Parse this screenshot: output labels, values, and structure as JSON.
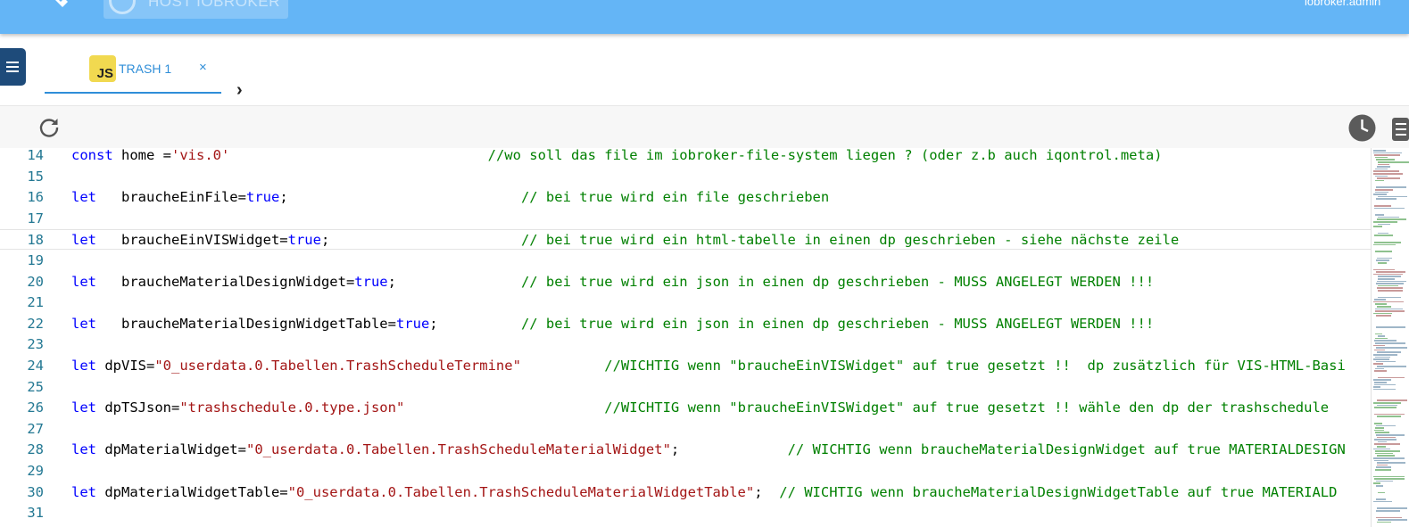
{
  "header": {
    "host_label": "HOST IOBROKER",
    "user_label": "iobroker.admin"
  },
  "icons": {
    "wrench": "wrench-icon",
    "host": "host-icon",
    "menu": "menu-icon",
    "reload": "reload-icon",
    "clock": "clock-icon",
    "list": "list-icon"
  },
  "tabs": [
    {
      "badge": "JS",
      "label": "TRASH 1",
      "close": "×"
    }
  ],
  "tab_scroll": "›",
  "colors": {
    "appbar": "#64b5f6",
    "tab_accent": "#2f8ed8",
    "keyword": "#0000ff",
    "string": "#a31515",
    "comment": "#008000",
    "line_number": "#237893"
  },
  "editor": {
    "current_line": "18",
    "lines": [
      {
        "n": "14",
        "parts": [
          {
            "t": "kw",
            "v": "const"
          },
          {
            "t": "p",
            "v": " home ="
          },
          {
            "t": "str",
            "v": "'vis.0'"
          },
          {
            "t": "p",
            "v": "                               "
          },
          {
            "t": "cm",
            "v": "//wo soll das file im iobroker-file-system liegen ? (oder z.b auch iqontrol.meta)"
          }
        ]
      },
      {
        "n": "15",
        "parts": []
      },
      {
        "n": "16",
        "parts": [
          {
            "t": "kw",
            "v": "let"
          },
          {
            "t": "p",
            "v": "   braucheEinFile="
          },
          {
            "t": "kw",
            "v": "true"
          },
          {
            "t": "p",
            "v": ";                            "
          },
          {
            "t": "cm",
            "v": "// bei true wird ein file geschrieben"
          }
        ]
      },
      {
        "n": "17",
        "parts": []
      },
      {
        "n": "18",
        "parts": [
          {
            "t": "kw",
            "v": "let"
          },
          {
            "t": "p",
            "v": "   braucheEinVISWidget="
          },
          {
            "t": "kw",
            "v": "true"
          },
          {
            "t": "p",
            "v": ";                       "
          },
          {
            "t": "cm",
            "v": "// bei true wird ein html-tabelle in einen dp geschrieben - siehe nächste zeile"
          }
        ]
      },
      {
        "n": "19",
        "parts": []
      },
      {
        "n": "20",
        "parts": [
          {
            "t": "kw",
            "v": "let"
          },
          {
            "t": "p",
            "v": "   braucheMaterialDesignWidget="
          },
          {
            "t": "kw",
            "v": "true"
          },
          {
            "t": "p",
            "v": ";               "
          },
          {
            "t": "cm",
            "v": "// bei true wird ein json in einen dp geschrieben - MUSS ANGELEGT WERDEN !!!"
          }
        ]
      },
      {
        "n": "21",
        "parts": []
      },
      {
        "n": "22",
        "parts": [
          {
            "t": "kw",
            "v": "let"
          },
          {
            "t": "p",
            "v": "   braucheMaterialDesignWidgetTable="
          },
          {
            "t": "kw",
            "v": "true"
          },
          {
            "t": "p",
            "v": ";          "
          },
          {
            "t": "cm",
            "v": "// bei true wird ein json in einen dp geschrieben - MUSS ANGELEGT WERDEN !!!"
          }
        ]
      },
      {
        "n": "23",
        "parts": []
      },
      {
        "n": "24",
        "parts": [
          {
            "t": "kw",
            "v": "let"
          },
          {
            "t": "p",
            "v": " dpVIS="
          },
          {
            "t": "str",
            "v": "\"0_userdata.0.Tabellen.TrashScheduleTermine\""
          },
          {
            "t": "p",
            "v": "          "
          },
          {
            "t": "cm",
            "v": "//WICHTIG wenn \"braucheEinVISWidget\" auf true gesetzt !!  dp zusätzlich für VIS-HTML-Basi"
          }
        ]
      },
      {
        "n": "25",
        "parts": []
      },
      {
        "n": "26",
        "parts": [
          {
            "t": "kw",
            "v": "let"
          },
          {
            "t": "p",
            "v": " dpTSJson="
          },
          {
            "t": "str",
            "v": "\"trashschedule.0.type.json\""
          },
          {
            "t": "p",
            "v": "                        "
          },
          {
            "t": "cm",
            "v": "//WICHTIG wenn \"braucheEinVISWidget\" auf true gesetzt !! wähle den dp der trashschedule"
          }
        ]
      },
      {
        "n": "27",
        "parts": []
      },
      {
        "n": "28",
        "parts": [
          {
            "t": "kw",
            "v": "let"
          },
          {
            "t": "p",
            "v": " dpMaterialWidget="
          },
          {
            "t": "str",
            "v": "\"0_userdata.0.Tabellen.TrashScheduleMaterialWidget\""
          },
          {
            "t": "p",
            "v": ";             "
          },
          {
            "t": "cm",
            "v": "// WICHTIG wenn braucheMaterialDesignWidget auf true MATERIALDESIGN"
          }
        ]
      },
      {
        "n": "29",
        "parts": []
      },
      {
        "n": "30",
        "parts": [
          {
            "t": "kw",
            "v": "let"
          },
          {
            "t": "p",
            "v": " dpMaterialWidgetTable="
          },
          {
            "t": "str",
            "v": "\"0_userdata.0.Tabellen.TrashScheduleMaterialWidgetTable\""
          },
          {
            "t": "p",
            "v": ";  "
          },
          {
            "t": "cm",
            "v": "// WICHTIG wenn braucheMaterialDesignWidgetTable auf true MATERIALD"
          }
        ]
      },
      {
        "n": "31",
        "parts": []
      }
    ]
  }
}
